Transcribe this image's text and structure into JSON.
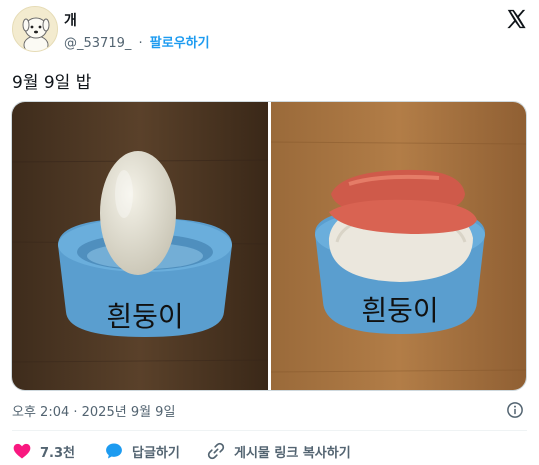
{
  "author": {
    "name": "개",
    "handle": "@_53719_",
    "separator": "·",
    "follow_label": "팔로우하기"
  },
  "tweet": {
    "text": "9월 9일 밥",
    "timestamp": "오후 2:04 · 2025년 9월 9일"
  },
  "media": {
    "bowl_text_left": "흰둥이",
    "bowl_text_right": "흰둥이"
  },
  "actions": {
    "like_count": "7.3천",
    "reply_label": "답글하기",
    "copy_label": "게시물 링크 복사하기"
  },
  "icons": {
    "platform": "x-logo-icon",
    "info": "info-icon",
    "like": "heart-icon",
    "reply": "speech-bubble-icon",
    "copy": "link-icon"
  },
  "colors": {
    "accent": "#1d9bf0",
    "like": "#f91880",
    "secondary_text": "#536471",
    "bowl": "#5a9ecf"
  }
}
